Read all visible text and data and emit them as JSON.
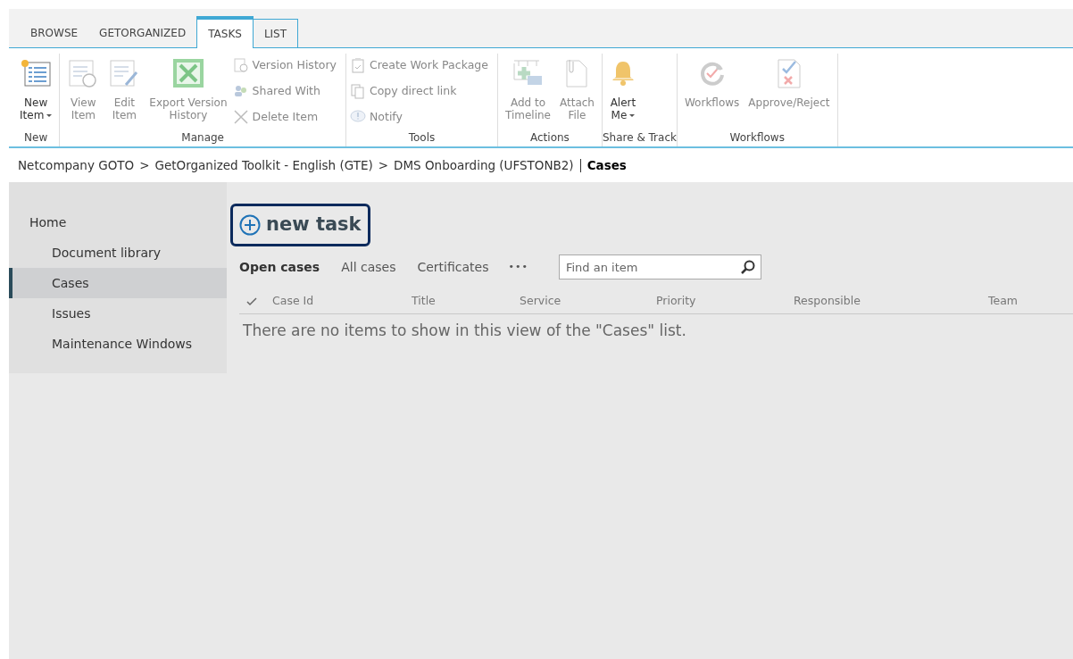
{
  "ribbon_tabs": [
    {
      "label": "BROWSE",
      "selected": false
    },
    {
      "label": "GETORGANIZED",
      "selected": false
    },
    {
      "label": "TASKS",
      "selected": true
    },
    {
      "label": "LIST",
      "selected": false
    }
  ],
  "ribbon_groups": [
    {
      "label": "New",
      "commands": [
        {
          "kind": "large",
          "label": "New\nItem",
          "dropdown": true,
          "disabled": false
        }
      ]
    },
    {
      "label": "Manage",
      "commands": [
        {
          "kind": "large",
          "label": "View\nItem",
          "dropdown": false,
          "disabled": true
        },
        {
          "kind": "large",
          "label": "Edit\nItem",
          "dropdown": false,
          "disabled": true
        },
        {
          "kind": "large",
          "label": "Export Version\nHistory",
          "dropdown": false,
          "disabled": true
        },
        {
          "kind": "stack",
          "items": [
            {
              "label": "Version History",
              "disabled": true
            },
            {
              "label": "Shared With",
              "disabled": true
            },
            {
              "label": "Delete Item",
              "disabled": true
            }
          ]
        }
      ]
    },
    {
      "label": "Tools",
      "commands": [
        {
          "kind": "stack",
          "items": [
            {
              "label": "Create Work Package",
              "disabled": true
            },
            {
              "label": "Copy direct link",
              "disabled": true
            },
            {
              "label": "Notify",
              "disabled": true
            }
          ]
        }
      ]
    },
    {
      "label": "Actions",
      "commands": [
        {
          "kind": "large",
          "label": "Add to\nTimeline",
          "dropdown": false,
          "disabled": true
        },
        {
          "kind": "large",
          "label": "Attach\nFile",
          "dropdown": false,
          "disabled": true
        }
      ]
    },
    {
      "label": "Share & Track",
      "commands": [
        {
          "kind": "large",
          "label": "Alert\nMe",
          "dropdown": true,
          "disabled": false
        }
      ]
    },
    {
      "label": "Workflows",
      "commands": [
        {
          "kind": "large",
          "label": "Workflows",
          "dropdown": false,
          "disabled": true
        },
        {
          "kind": "large",
          "label": "Approve/Reject",
          "dropdown": false,
          "disabled": true
        }
      ]
    }
  ],
  "breadcrumb": {
    "separator": ">",
    "path": [
      "Netcompany GOTO",
      "GetOrganized Toolkit - English (GTE)",
      "DMS Onboarding (UFSTONB2)"
    ],
    "current": "Cases"
  },
  "sidebar": {
    "items": [
      {
        "label": "Home",
        "selected": false,
        "children": [
          {
            "label": "Document library",
            "selected": false
          },
          {
            "label": "Cases",
            "selected": true
          },
          {
            "label": "Issues",
            "selected": false
          },
          {
            "label": "Maintenance Windows",
            "selected": false
          }
        ]
      }
    ]
  },
  "new_task": {
    "label": "new task"
  },
  "views": [
    {
      "label": "Open cases",
      "selected": true
    },
    {
      "label": "All cases",
      "selected": false
    },
    {
      "label": "Certificates",
      "selected": false
    }
  ],
  "more": "•••",
  "search": {
    "placeholder": "Find an item"
  },
  "table": {
    "columns": [
      "Case Id",
      "Title",
      "Service",
      "Priority",
      "Responsible",
      "Team"
    ],
    "empty_message": "There are no items to show in this view of the \"Cases\" list."
  }
}
